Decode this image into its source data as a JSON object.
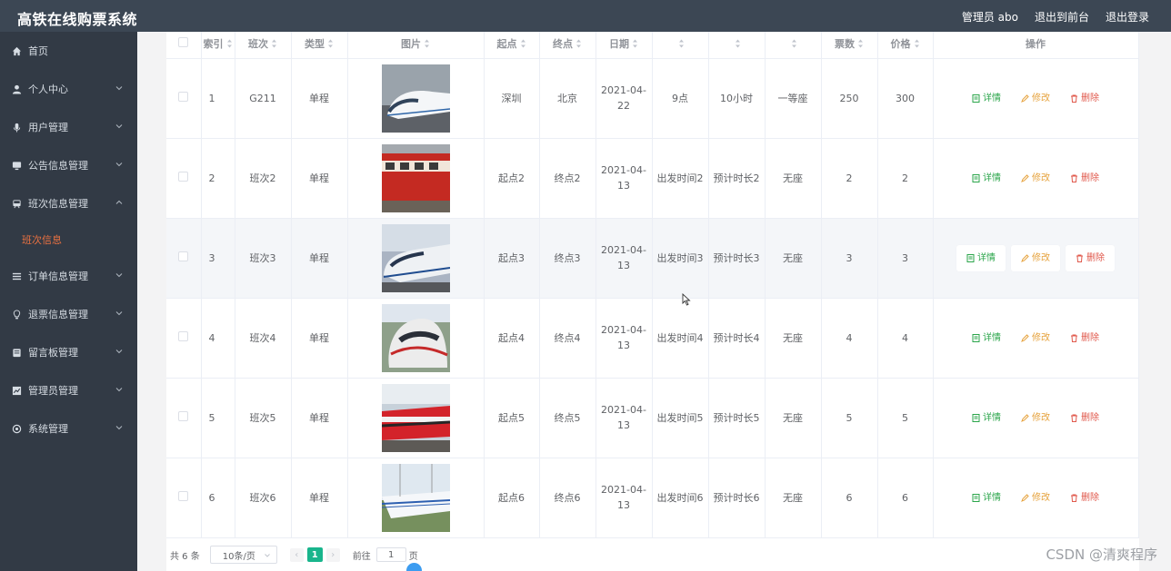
{
  "header": {
    "title": "高铁在线购票系统",
    "admin_label": "管理员 abo",
    "back_label": "退出到前台",
    "logout_label": "退出登录"
  },
  "sidebar": {
    "items": [
      {
        "label": "首页",
        "icon": "home-icon"
      },
      {
        "label": "个人中心",
        "icon": "user-icon"
      },
      {
        "label": "用户管理",
        "icon": "mic-icon"
      },
      {
        "label": "公告信息管理",
        "icon": "monitor-icon"
      },
      {
        "label": "班次信息管理",
        "icon": "train-icon"
      },
      {
        "label": "订单信息管理",
        "icon": "list-icon"
      },
      {
        "label": "退票信息管理",
        "icon": "bulb-icon"
      },
      {
        "label": "留言板管理",
        "icon": "board-icon"
      },
      {
        "label": "管理员管理",
        "icon": "chart-icon"
      },
      {
        "label": "系统管理",
        "icon": "settings-icon"
      }
    ],
    "sub_item_label": "班次信息"
  },
  "table": {
    "headers": [
      "索引",
      "班次",
      "类型",
      "图片",
      "起点",
      "终点",
      "日期",
      "",
      "",
      "",
      "票数",
      "价格",
      "操作"
    ],
    "actions": {
      "detail": "详情",
      "edit": "修改",
      "delete": "删除"
    },
    "rows": [
      {
        "index": "1",
        "number": "G211",
        "type": "单程",
        "origin": "深圳",
        "dest": "北京",
        "date": "2021-04-22",
        "depart": "9点",
        "duration": "10小时",
        "seat": "一等座",
        "tickets": "250",
        "price": "300"
      },
      {
        "index": "2",
        "number": "班次2",
        "type": "单程",
        "origin": "起点2",
        "dest": "终点2",
        "date": "2021-04-13",
        "depart": "出发时间2",
        "duration": "预计时长2",
        "seat": "无座",
        "tickets": "2",
        "price": "2"
      },
      {
        "index": "3",
        "number": "班次3",
        "type": "单程",
        "origin": "起点3",
        "dest": "终点3",
        "date": "2021-04-13",
        "depart": "出发时间3",
        "duration": "预计时长3",
        "seat": "无座",
        "tickets": "3",
        "price": "3"
      },
      {
        "index": "4",
        "number": "班次4",
        "type": "单程",
        "origin": "起点4",
        "dest": "终点4",
        "date": "2021-04-13",
        "depart": "出发时间4",
        "duration": "预计时长4",
        "seat": "无座",
        "tickets": "4",
        "price": "4"
      },
      {
        "index": "5",
        "number": "班次5",
        "type": "单程",
        "origin": "起点5",
        "dest": "终点5",
        "date": "2021-04-13",
        "depart": "出发时间5",
        "duration": "预计时长5",
        "seat": "无座",
        "tickets": "5",
        "price": "5"
      },
      {
        "index": "6",
        "number": "班次6",
        "type": "单程",
        "origin": "起点6",
        "dest": "终点6",
        "date": "2021-04-13",
        "depart": "出发时间6",
        "duration": "预计时长6",
        "seat": "无座",
        "tickets": "6",
        "price": "6"
      }
    ]
  },
  "pagination": {
    "total": "共 6 条",
    "page_size": "10条/页",
    "current": "1",
    "goto_prefix": "前往",
    "goto_value": "1",
    "goto_suffix": "页"
  },
  "watermark": "CSDN @清爽程序",
  "colors": {
    "topbar": "#3c4754",
    "sidebar": "#323a45",
    "active": "#ea7141",
    "accent": "#19b58c",
    "detail": "#2aa54a",
    "edit": "#e6a23c",
    "delete": "#e0584b"
  }
}
